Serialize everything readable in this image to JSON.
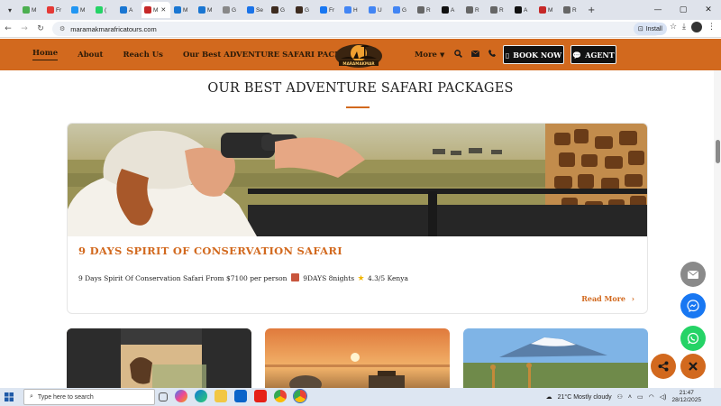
{
  "browser": {
    "tabs": [
      "M",
      "Fr",
      "M",
      "(",
      "A",
      "M",
      "M",
      "M",
      "G",
      "Se",
      "G",
      "G",
      "Fr",
      "H",
      "U",
      "G",
      "R",
      "A",
      "R",
      "R",
      "A",
      "M",
      "R"
    ],
    "active_tab_label": "M",
    "url": "maramakmarafricatours.com",
    "install_label": "Install"
  },
  "site": {
    "nav": {
      "home": "Home",
      "about": "About",
      "reach": "Reach Us",
      "packages": "Our Best ADVENTURE SAFARI PACKAGES",
      "more": "More"
    },
    "logo_text": "MARAMAKMAR",
    "book_now": "BOOK NOW",
    "agent": "AGENT",
    "accent_color": "#d2691e"
  },
  "section": {
    "title": "OUR BEST ADVENTURE SAFARI PACKAGES"
  },
  "featured": {
    "title": "9 DAYS SPIRIT OF CONSERVATION SAFARI",
    "desc_a": "9 Days Spirit Of Conservation Safari From $7100 per person",
    "desc_b": "9DAYS 8nights",
    "desc_c": "4.3/5 Kenya",
    "read_more": "Read More"
  },
  "taskbar": {
    "search_placeholder": "Type here to search",
    "weather": "21°C  Mostly cloudy",
    "time": "21:47",
    "date": "28/12/2025"
  }
}
